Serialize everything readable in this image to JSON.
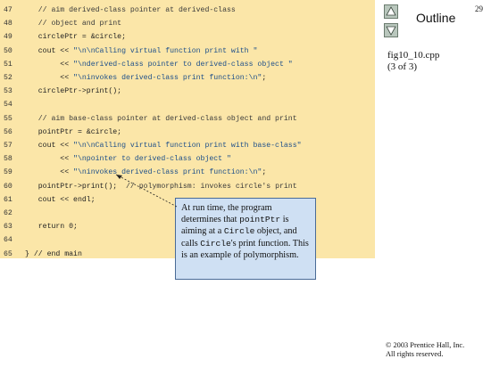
{
  "slide": {
    "page_number": "29",
    "outline_label": "Outline",
    "file_name": "fig10_10.cpp",
    "file_part": "(3 of 3)",
    "copyright_line1": "© 2003 Prentice Hall, Inc.",
    "copyright_line2": "All rights reserved.",
    "nav_up_icon": "up-triangle-icon",
    "nav_down_icon": "down-triangle-icon"
  },
  "code": [
    {
      "num": "47",
      "segments": [
        {
          "t": "   // aim derived-class pointer at derived-class",
          "k": "cm"
        }
      ]
    },
    {
      "num": "48",
      "segments": [
        {
          "t": "   // object and print",
          "k": "cm"
        }
      ]
    },
    {
      "num": "49",
      "segments": [
        {
          "t": "   circlePtr = &circle;",
          "k": ""
        }
      ]
    },
    {
      "num": "50",
      "segments": [
        {
          "t": "   cout << ",
          "k": ""
        },
        {
          "t": "\"\\n\\nCalling virtual function print with \"",
          "k": "st"
        }
      ]
    },
    {
      "num": "51",
      "segments": [
        {
          "t": "        << ",
          "k": ""
        },
        {
          "t": "\"\\nderived-class pointer to derived-class object \"",
          "k": "st"
        }
      ]
    },
    {
      "num": "52",
      "segments": [
        {
          "t": "        << ",
          "k": ""
        },
        {
          "t": "\"\\ninvokes derived-class print function:\\n\"",
          "k": "st"
        },
        {
          "t": ";",
          "k": ""
        }
      ]
    },
    {
      "num": "53",
      "segments": [
        {
          "t": "   circlePtr->print();",
          "k": ""
        }
      ]
    },
    {
      "num": "54",
      "segments": [
        {
          "t": "",
          "k": ""
        }
      ]
    },
    {
      "num": "55",
      "segments": [
        {
          "t": "   // aim base-class pointer at derived-class object and print",
          "k": "cm"
        }
      ]
    },
    {
      "num": "56",
      "segments": [
        {
          "t": "   pointPtr = &circle;",
          "k": ""
        }
      ]
    },
    {
      "num": "57",
      "segments": [
        {
          "t": "   cout << ",
          "k": ""
        },
        {
          "t": "\"\\n\\nCalling virtual function print with base-class\"",
          "k": "st"
        }
      ]
    },
    {
      "num": "58",
      "segments": [
        {
          "t": "        << ",
          "k": ""
        },
        {
          "t": "\"\\npointer to derived-class object \"",
          "k": "st"
        }
      ]
    },
    {
      "num": "59",
      "segments": [
        {
          "t": "        << ",
          "k": ""
        },
        {
          "t": "\"\\ninvokes derived-class print function:\\n\"",
          "k": "st"
        },
        {
          "t": ";",
          "k": ""
        }
      ]
    },
    {
      "num": "60",
      "segments": [
        {
          "t": "   pointPtr->print();  ",
          "k": ""
        },
        {
          "t": "// polymorphism: invokes circle's print",
          "k": "cm"
        }
      ]
    },
    {
      "num": "61",
      "segments": [
        {
          "t": "   cout << endl;",
          "k": ""
        }
      ]
    },
    {
      "num": "62",
      "segments": [
        {
          "t": "",
          "k": ""
        }
      ]
    },
    {
      "num": "63",
      "segments": [
        {
          "t": "   return 0;",
          "k": ""
        }
      ]
    },
    {
      "num": "64",
      "segments": [
        {
          "t": "",
          "k": ""
        }
      ]
    },
    {
      "num": "65",
      "segments": [
        {
          "t": "} // end main",
          "k": ""
        }
      ]
    }
  ],
  "callout": {
    "p1": "At run time, the program determines that ",
    "m1": "pointPtr",
    "p2": " is aiming at a ",
    "m2": "Circle",
    "p3": " object, and calls ",
    "m3": "Circle",
    "p4": "'s print function. This is an example of polymorphism."
  },
  "colors": {
    "code_background": "#fbe6a8",
    "callout_background": "#cfe0f3",
    "string_color": "#1d4f8a"
  }
}
